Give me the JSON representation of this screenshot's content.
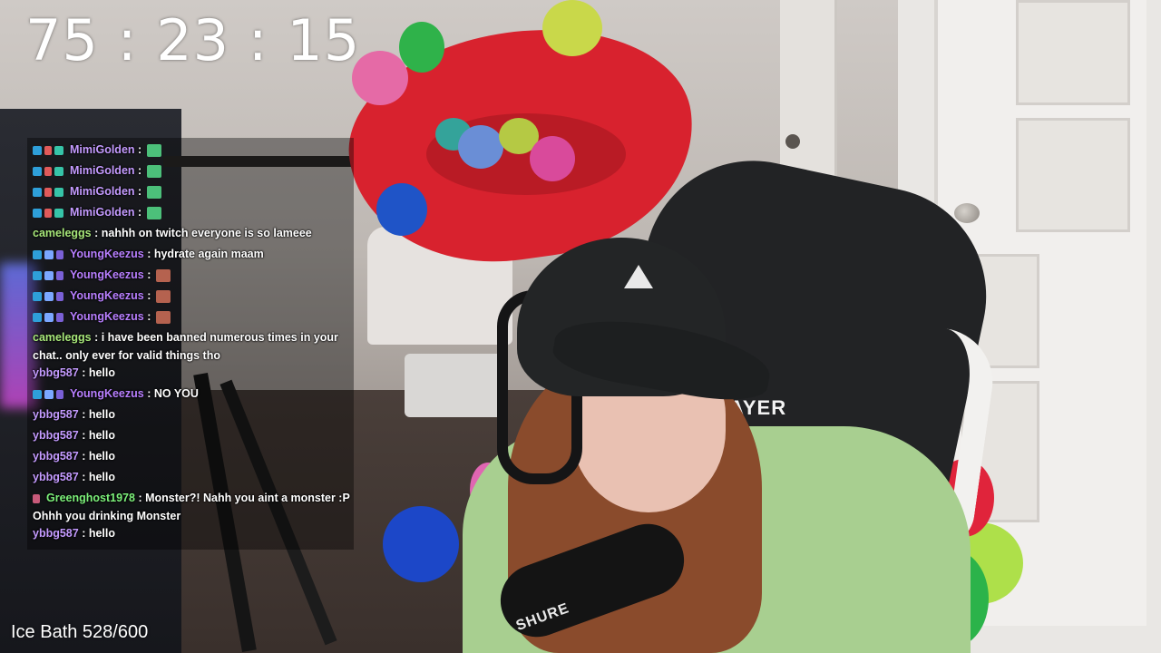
{
  "overlay": {
    "timer": "75 : 23 : 15",
    "counter": "Ice Bath 528/600"
  },
  "scene": {
    "chair_brand": "AYER",
    "mic_brand": "SHURE"
  },
  "colors": {
    "chat_username_purple": "#c49bff",
    "chat_username_green": "#a8e87a",
    "chat_username_yellow": "#8fe07a",
    "chat_username_lilac": "#b87fff",
    "chat_username_red": "#7cf07a",
    "chat_background": "rgba(0,0,0,0.38)"
  },
  "chat": {
    "messages": [
      {
        "user": "MimiGolden",
        "color": "#c49bff",
        "badges": [
          "prime",
          "sub",
          "bits"
        ],
        "text": "",
        "emote": "frog"
      },
      {
        "user": "MimiGolden",
        "color": "#c49bff",
        "badges": [
          "prime",
          "sub",
          "bits"
        ],
        "text": "",
        "emote": "frog"
      },
      {
        "user": "MimiGolden",
        "color": "#c49bff",
        "badges": [
          "prime",
          "sub",
          "bits"
        ],
        "text": "",
        "emote": "frog"
      },
      {
        "user": "MimiGolden",
        "color": "#c49bff",
        "badges": [
          "prime",
          "sub",
          "bits"
        ],
        "text": "",
        "emote": "frog"
      },
      {
        "user": "cameleggs",
        "color": "#a8e87a",
        "badges": [],
        "text": "nahhh on twitch everyone is so lameee",
        "emote": ""
      },
      {
        "user": "YoungKeezus",
        "color": "#b87fff",
        "badges": [
          "prime",
          "mod",
          "gift"
        ],
        "text": "hydrate again maam",
        "emote": ""
      },
      {
        "user": "YoungKeezus",
        "color": "#b87fff",
        "badges": [
          "prime",
          "mod",
          "gift"
        ],
        "text": "",
        "emote": "box"
      },
      {
        "user": "YoungKeezus",
        "color": "#b87fff",
        "badges": [
          "prime",
          "mod",
          "gift"
        ],
        "text": "",
        "emote": "box"
      },
      {
        "user": "YoungKeezus",
        "color": "#b87fff",
        "badges": [
          "prime",
          "mod",
          "gift"
        ],
        "text": "",
        "emote": "box"
      },
      {
        "user": "cameleggs",
        "color": "#a8e87a",
        "badges": [],
        "text": "i have been banned numerous times in your chat.. only ever for valid things tho",
        "emote": ""
      },
      {
        "user": "ybbg587",
        "color": "#c49bff",
        "badges": [],
        "text": "hello",
        "emote": ""
      },
      {
        "user": "YoungKeezus",
        "color": "#b87fff",
        "badges": [
          "prime",
          "mod",
          "gift"
        ],
        "text": "NO YOU",
        "emote": ""
      },
      {
        "user": "ybbg587",
        "color": "#c49bff",
        "badges": [],
        "text": "hello",
        "emote": ""
      },
      {
        "user": "ybbg587",
        "color": "#c49bff",
        "badges": [],
        "text": "hello",
        "emote": ""
      },
      {
        "user": "ybbg587",
        "color": "#c49bff",
        "badges": [],
        "text": "hello",
        "emote": ""
      },
      {
        "user": "ybbg587",
        "color": "#c49bff",
        "badges": [],
        "text": "hello",
        "emote": ""
      },
      {
        "user": "Greenghost1978",
        "color": "#7cf07a",
        "badges": [
          "fox"
        ],
        "text": "Monster?! Nahh you aint a monster :P Ohhh you drinking Monster",
        "emote": ""
      },
      {
        "user": "ybbg587",
        "color": "#c49bff",
        "badges": [],
        "text": "hello",
        "emote": ""
      }
    ]
  }
}
